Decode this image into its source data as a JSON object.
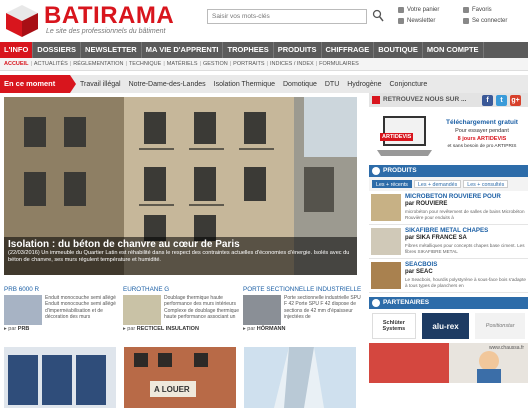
{
  "header": {
    "logo_text": "BATIRAMA",
    "tagline": "Le site des professionnels du bâtiment",
    "search_placeholder": "Saisir vos mots-clés",
    "links": [
      "Votre panier",
      "Favoris",
      "Newsletter",
      "Se connecter"
    ]
  },
  "nav": {
    "items": [
      "L'INFO",
      "DOSSIERS",
      "NEWSLETTER",
      "MA VIE D'APPRENTI",
      "TROPHEES",
      "PRODUITS",
      "CHIFFRAGE",
      "BOUTIQUE",
      "MON COMPTE"
    ],
    "active": "L'INFO"
  },
  "subnav": {
    "items": [
      "ACCUEIL",
      "ACTUALITÉS",
      "RÉGLEMENTATION",
      "TECHNIQUE",
      "MATÉRIELS",
      "GESTION",
      "PORTRAITS",
      "INDICES / INDEX",
      "FORMULAIRES"
    ],
    "active": "ACCUEIL"
  },
  "moment": {
    "label": "En ce moment",
    "tags": [
      "Travail illégal",
      "Notre-Dame-des-Landes",
      "Isolation Thermique",
      "Domotique",
      "DTU",
      "Hydrogène",
      "Conjoncture"
    ]
  },
  "hero": {
    "title": "Isolation : du béton de chanvre au cœur de Paris",
    "text": "(22/03/2016) Un immeuble du Quartier Latin est réhabilité dans le respect des contraintes actuelles d'économies d'énergie. Isolés avec du béton de chanvre, ses murs régulent température et humidité."
  },
  "cards": [
    {
      "title": "PRB 6000 R",
      "text": "Enduit monocouche semi allégé Enduit monocouche semi allégé d'imperméabilisation et de décoration des murs",
      "by_label": "par",
      "by": "PRB"
    },
    {
      "title": "EUROTHANE G",
      "text": "Doublage thermique haute performance des murs intérieurs Complexe de doublage thermique haute performance associant un",
      "by_label": "par",
      "by": "RECTICEL INSULATION"
    },
    {
      "title": "PORTE SECTIONNELLE INDUSTRIELLE",
      "text": "Porte sectionnelle industrielle SPU F 42 Porte SPU F 42 dispose de sections de 42 mm d'épaisseur injectées de",
      "by_label": "par",
      "by": "HÖRMANN"
    }
  ],
  "bottom_photo_text": "A LOUER",
  "sidebar": {
    "social_title": "RETROUVEZ NOUS SUR ...",
    "social": [
      "f",
      "t",
      "g+"
    ],
    "ad": {
      "brand": "ARTIDEVIS",
      "line1": "Téléchargement gratuit",
      "line2": "Pour essayer pendant",
      "line3": "8 jours ARTIDEVIS",
      "line4": "et sans besoin de pro ARTIPRIS"
    },
    "products_title": "PRODUITS",
    "tabs": [
      "Les + récents",
      "Les + demandés",
      "Les + consultés"
    ],
    "active_tab": "Les + récents",
    "products": [
      {
        "name": "MICROBETON ROUVIERE POUR",
        "by": "par ROUVIERE",
        "desc": "microbéton pour revêtement de salles de bains Microbéton Rouvière pour enduits à"
      },
      {
        "name": "SIKAFIBRE METAL CHAPES",
        "by": "par SIKA FRANCE SA",
        "desc": "Fibres métalliques pour concepts chapes base ciment. Les fibres SIKAFIBRE METAL"
      },
      {
        "name": "SEACBOIS",
        "by": "par SEAC",
        "desc": "Le Seacbois, hourdis polystyrène à sous-face bois s'adapte à tous types de planchers en"
      }
    ],
    "partners_title": "PARTENAIRES",
    "partners": [
      "Schlüter Systems",
      "alu-rex",
      "Positionstar"
    ],
    "footer_ad": "www.chaussa.fr"
  }
}
